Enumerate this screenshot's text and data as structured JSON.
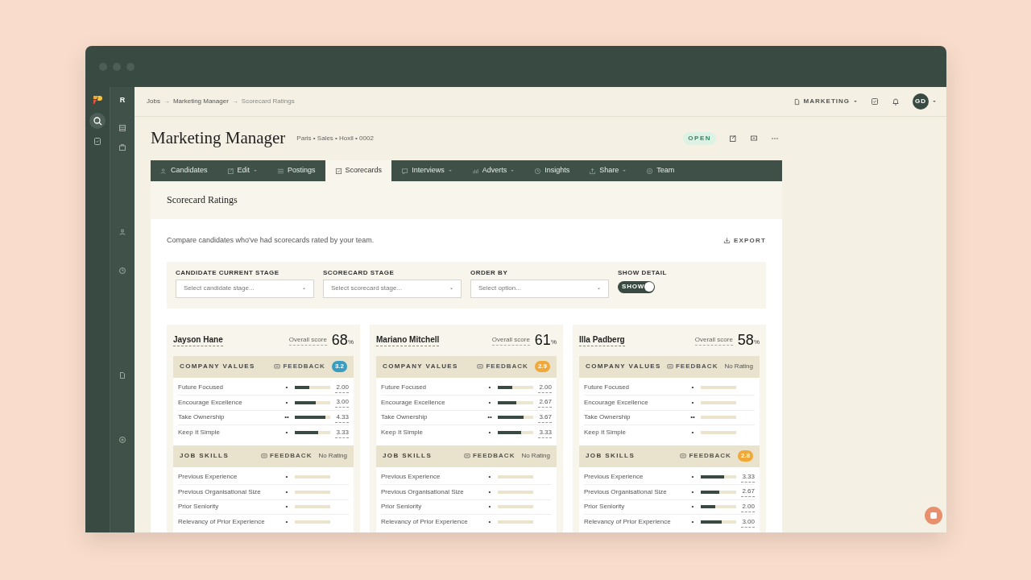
{
  "sidebar": {
    "project_initial": "R"
  },
  "breadcrumb": {
    "items": [
      "Jobs",
      "Marketing Manager",
      "Scorecard Ratings"
    ],
    "separator": "→"
  },
  "topbar": {
    "workspace": "MARKETING",
    "avatar": "GD"
  },
  "job": {
    "title": "Marketing Manager",
    "meta": "Paris • Sales • Hoxll • 0002",
    "status": "OPEN"
  },
  "tabs": [
    {
      "label": "Candidates",
      "selected": false,
      "dropdown": false
    },
    {
      "label": "Edit",
      "selected": false,
      "dropdown": true
    },
    {
      "label": "Postings",
      "selected": false,
      "dropdown": false
    },
    {
      "label": "Scorecards",
      "selected": true,
      "dropdown": false
    },
    {
      "label": "Interviews",
      "selected": false,
      "dropdown": true
    },
    {
      "label": "Adverts",
      "selected": false,
      "dropdown": true
    },
    {
      "label": "Insights",
      "selected": false,
      "dropdown": false
    },
    {
      "label": "Share",
      "selected": false,
      "dropdown": true
    },
    {
      "label": "Team",
      "selected": false,
      "dropdown": false
    }
  ],
  "panel": {
    "title": "Scorecard Ratings",
    "description": "Compare candidates who've had scorecards rated by your team.",
    "export": "EXPORT"
  },
  "filters": [
    {
      "label": "CANDIDATE CURRENT STAGE",
      "placeholder": "Select candidate stage..."
    },
    {
      "label": "SCORECARD STAGE",
      "placeholder": "Select scorecard stage..."
    },
    {
      "label": "ORDER BY",
      "placeholder": "Select option..."
    }
  ],
  "show_detail": {
    "label": "SHOW DETAIL",
    "toggle_text": "SHOW",
    "on": true
  },
  "candidates": [
    {
      "name": "Jayson Hane",
      "overall_label": "Overall score",
      "score": "68",
      "unit": "%",
      "sections": [
        {
          "title": "COMPANY VALUES",
          "feedback": "FEEDBACK",
          "kind": "badge",
          "rating": "3.2",
          "color": "#3a9cc0",
          "rows": [
            {
              "label": "Future Focused",
              "dots": "•",
              "level": 0.4,
              "value": "2.00"
            },
            {
              "label": "Encourage Excellence",
              "dots": "•",
              "level": 0.6,
              "value": "3.00"
            },
            {
              "label": "Take Ownership",
              "dots": "••",
              "level": 0.87,
              "value": "4.33"
            },
            {
              "label": "Keep It Simple",
              "dots": "•",
              "level": 0.67,
              "value": "3.33"
            }
          ]
        },
        {
          "title": "JOB SKILLS",
          "feedback": "FEEDBACK",
          "kind": "text",
          "rating": "No Rating",
          "rows": [
            {
              "label": "Previous Experience",
              "dots": "•"
            },
            {
              "label": "Previous Organisational Size",
              "dots": "•"
            },
            {
              "label": "Prior Seniority",
              "dots": "•"
            },
            {
              "label": "Relevancy of Prior Experience",
              "dots": "•"
            }
          ]
        }
      ]
    },
    {
      "name": "Mariano Mitchell",
      "overall_label": "Overall score",
      "score": "61",
      "unit": "%",
      "sections": [
        {
          "title": "COMPANY VALUES",
          "feedback": "FEEDBACK",
          "kind": "badge",
          "rating": "2.9",
          "color": "#f0a838",
          "rows": [
            {
              "label": "Future Focused",
              "dots": "•",
              "level": 0.4,
              "value": "2.00"
            },
            {
              "label": "Encourage Excellence",
              "dots": "•",
              "level": 0.53,
              "value": "2.67"
            },
            {
              "label": "Take Ownership",
              "dots": "••",
              "level": 0.73,
              "value": "3.67"
            },
            {
              "label": "Keep It Simple",
              "dots": "•",
              "level": 0.67,
              "value": "3.33"
            }
          ]
        },
        {
          "title": "JOB SKILLS",
          "feedback": "FEEDBACK",
          "kind": "text",
          "rating": "No Rating",
          "rows": [
            {
              "label": "Previous Experience",
              "dots": "•"
            },
            {
              "label": "Previous Organisational Size",
              "dots": "•"
            },
            {
              "label": "Prior Seniority",
              "dots": "•"
            },
            {
              "label": "Relevancy of Prior Experience",
              "dots": "•"
            }
          ]
        }
      ]
    },
    {
      "name": "Illa Padberg",
      "overall_label": "Overall score",
      "score": "58",
      "unit": "%",
      "sections": [
        {
          "title": "COMPANY VALUES",
          "feedback": "FEEDBACK",
          "kind": "text",
          "rating": "No Rating",
          "rows": [
            {
              "label": "Future Focused",
              "dots": "•"
            },
            {
              "label": "Encourage Excellence",
              "dots": "•"
            },
            {
              "label": "Take Ownership",
              "dots": "••"
            },
            {
              "label": "Keep It Simple",
              "dots": "•"
            }
          ]
        },
        {
          "title": "JOB SKILLS",
          "feedback": "FEEDBACK",
          "kind": "badge",
          "rating": "2.8",
          "color": "#f0a838",
          "rows": [
            {
              "label": "Previous Experience",
              "dots": "•",
              "level": 0.67,
              "value": "3.33"
            },
            {
              "label": "Previous Organisational Size",
              "dots": "•",
              "level": 0.53,
              "value": "2.67"
            },
            {
              "label": "Prior Seniority",
              "dots": "•",
              "level": 0.4,
              "value": "2.00"
            },
            {
              "label": "Relevancy of Prior Experience",
              "dots": "•",
              "level": 0.6,
              "value": "3.00"
            }
          ]
        }
      ]
    }
  ]
}
